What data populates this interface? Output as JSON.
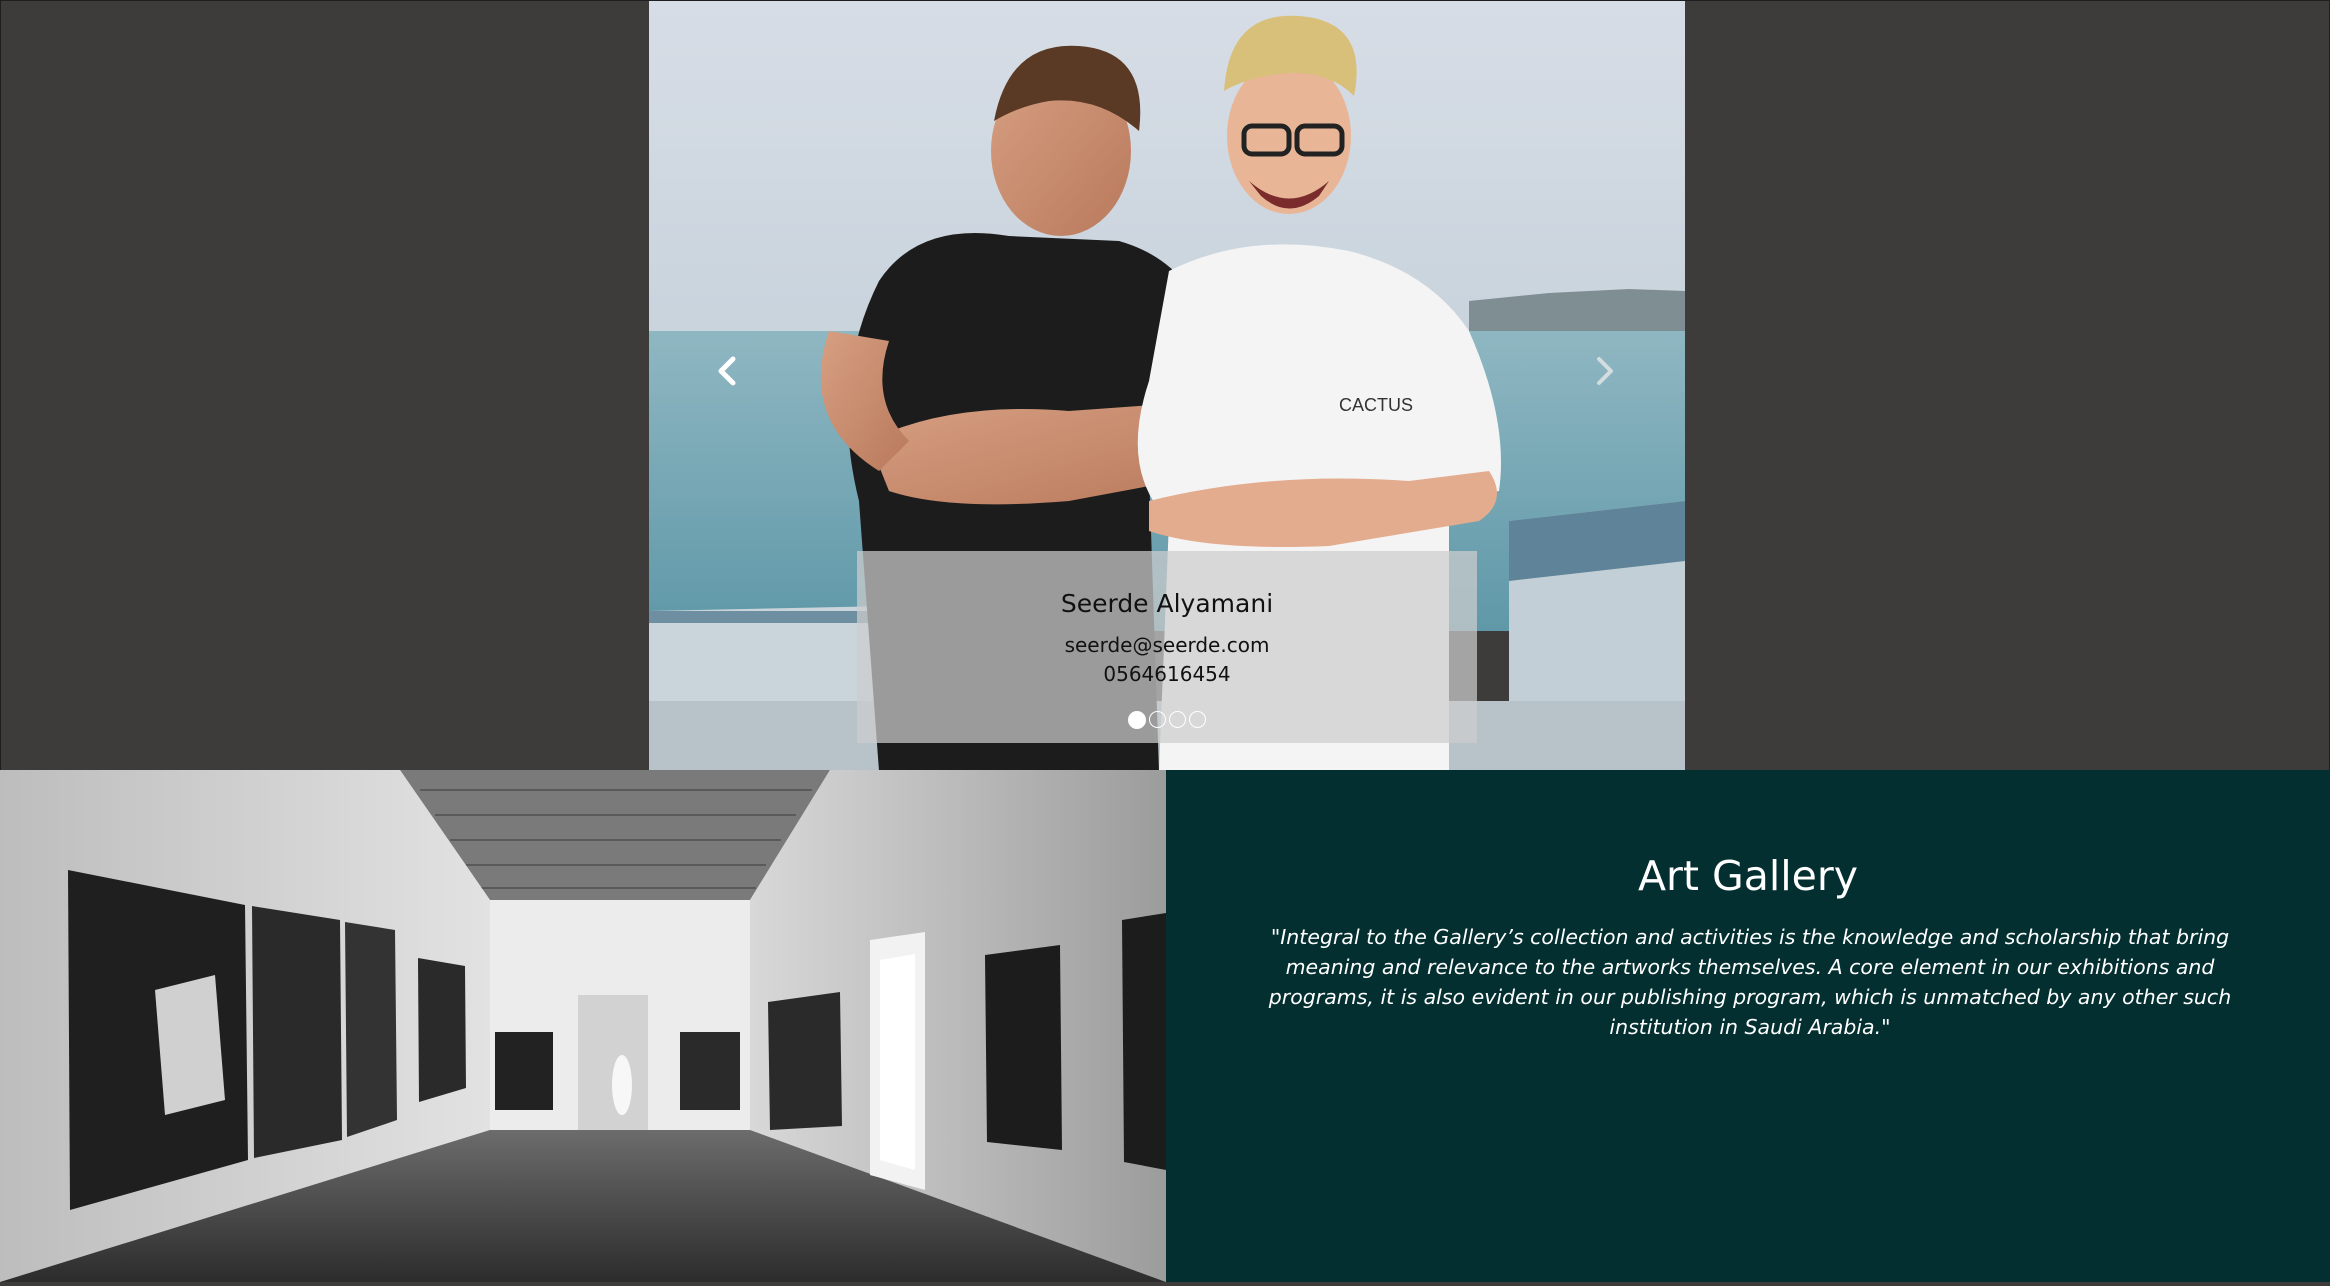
{
  "carousel": {
    "name": "Seerde Alyamani",
    "email": "seerde@seerde.com",
    "phone": "0564616454",
    "prev_icon": "chevron-left-icon",
    "next_icon": "chevron-right-icon",
    "indicators": [
      {
        "active": true
      },
      {
        "active": false
      },
      {
        "active": false
      },
      {
        "active": false
      }
    ]
  },
  "gallery": {
    "title": "Art Gallery",
    "quote": "\"Integral to the Gallery’s collection and activities is the knowledge and scholarship that bring meaning and relevance to the artworks themselves. A core element in our exhibitions and programs, it is also evident in our publishing program, which is unmatched by any other such institution in Saudi Arabia.\""
  },
  "colors": {
    "page_background": "#3d3c3b",
    "gallery_panel": "#032f30",
    "caption_overlay": "#cdcdcd"
  }
}
